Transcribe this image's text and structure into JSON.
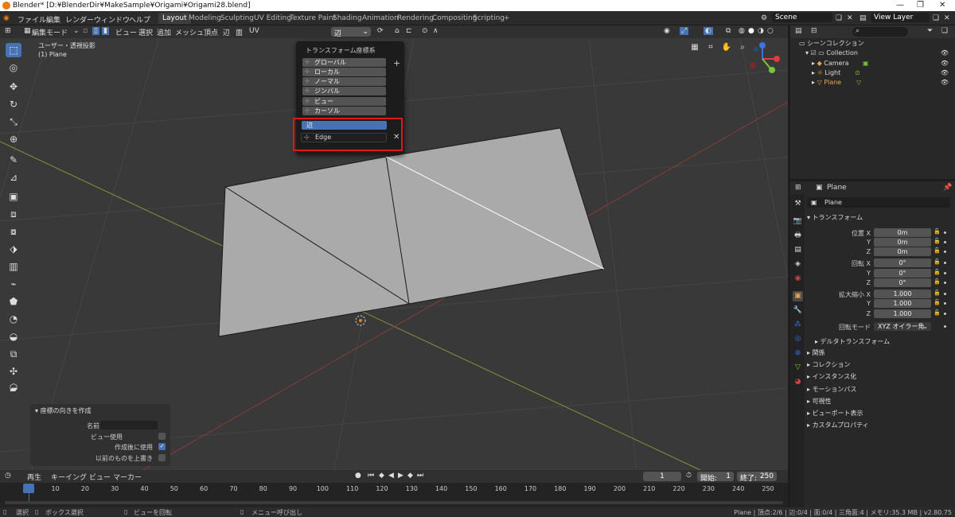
{
  "window": {
    "title": "Blender* [D:¥BlenderDir¥MakeSample¥Origami¥Origami28.blend]"
  },
  "menu": [
    "ファイル",
    "編集",
    "レンダー",
    "ウィンドウ",
    "ヘルプ"
  ],
  "workspaces": [
    "Layout",
    "Modeling",
    "Sculpting",
    "UV Editing",
    "Texture Paint",
    "Shading",
    "Animation",
    "Rendering",
    "Compositing",
    "Scripting",
    "+"
  ],
  "scene": {
    "scene_label": "Scene",
    "view_layer_label": "View Layer"
  },
  "viewport_header": {
    "mode": "編集モード",
    "menus": [
      "ビュー",
      "選択",
      "追加",
      "メッシュ",
      "頂点",
      "辺",
      "面",
      "UV"
    ],
    "orientation": "辺"
  },
  "viewport": {
    "view_name": "ユーザー・透視投影",
    "object_name": "(1) Plane"
  },
  "orientation_popup": {
    "title": "トランスフォーム座標系",
    "options": [
      "グローバル",
      "ローカル",
      "ノーマル",
      "ジンバル",
      "ビュー",
      "カーソル",
      "辺"
    ],
    "active": "辺",
    "custom_name": "Edge"
  },
  "operator_panel": {
    "title": "座標の向きを作成",
    "name_label": "名前",
    "name_value": "",
    "use_view": {
      "label": "ビュー使用",
      "checked": false
    },
    "use_after": {
      "label": "作成後に使用",
      "checked": true
    },
    "overwrite": {
      "label": "以前のものを上書き",
      "checked": false
    }
  },
  "timeline": {
    "menus": [
      "再生",
      "キーイング",
      "ビュー",
      "マーカー"
    ],
    "current_frame": "1",
    "start_label": "開始:",
    "start_value": "1",
    "end_label": "終了:",
    "end_value": "250",
    "ticks": [
      "1",
      "10",
      "20",
      "30",
      "40",
      "50",
      "60",
      "70",
      "80",
      "90",
      "100",
      "110",
      "120",
      "130",
      "140",
      "150",
      "160",
      "170",
      "180",
      "190",
      "200",
      "210",
      "220",
      "230",
      "240",
      "250"
    ]
  },
  "statusbar": {
    "left": [
      "選択",
      "ボックス選択",
      "ビューを回転",
      "メニュー呼び出し"
    ],
    "right": "Plane | 頂点:2/6 | 辺:0/4 | 面:0/4 | 三角面:4 | メモリ:35.3 MB | v2.80.75"
  },
  "outliner": {
    "root": "シーンコレクション",
    "collection": "Collection",
    "items": [
      "Camera",
      "Light",
      "Plane"
    ],
    "active_item": "Plane"
  },
  "properties": {
    "object_name": "Plane",
    "data_name": "Plane",
    "transform_header": "トランスフォーム",
    "location_label": "位置 X",
    "location": [
      "0m",
      "0m",
      "0m"
    ],
    "rotation_label": "回転 X",
    "rotation": [
      "0°",
      "0°",
      "0°"
    ],
    "scale_label": "拡大縮小 X",
    "scale": [
      "1.000",
      "1.000",
      "1.000"
    ],
    "axis_y": "Y",
    "axis_z": "Z",
    "rotation_mode_label": "回転モード",
    "rotation_mode": "XYZ オイラー角",
    "delta": "デルタトランスフォーム",
    "sections": [
      "関係",
      "コレクション",
      "インスタンス化",
      "モーションパス",
      "可視性",
      "ビューポート表示",
      "カスタムプロパティ"
    ]
  },
  "colors": {
    "accent": "#4772b3",
    "highlight": "#e01818",
    "active_object": "#e8a64a"
  }
}
